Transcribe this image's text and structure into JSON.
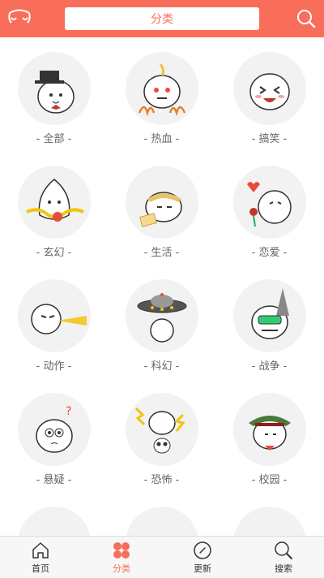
{
  "header": {
    "title": "分类"
  },
  "categories": [
    {
      "label": "- 全部 -"
    },
    {
      "label": "- 热血 -"
    },
    {
      "label": "- 搞笑 -"
    },
    {
      "label": "- 玄幻 -"
    },
    {
      "label": "- 生活 -"
    },
    {
      "label": "- 恋爱 -"
    },
    {
      "label": "- 动作 -"
    },
    {
      "label": "- 科幻 -"
    },
    {
      "label": "- 战争 -"
    },
    {
      "label": "- 悬疑 -"
    },
    {
      "label": "- 恐怖 -"
    },
    {
      "label": "- 校园 -"
    }
  ],
  "tabs": [
    {
      "label": "首页",
      "icon": "home-icon"
    },
    {
      "label": "分类",
      "icon": "clover-icon"
    },
    {
      "label": "更新",
      "icon": "compass-icon"
    },
    {
      "label": "搜索",
      "icon": "search-icon"
    }
  ],
  "colors": {
    "accent": "#f96e5b",
    "header": "#f96e5b",
    "avatar_bg": "#f2f2f2"
  }
}
